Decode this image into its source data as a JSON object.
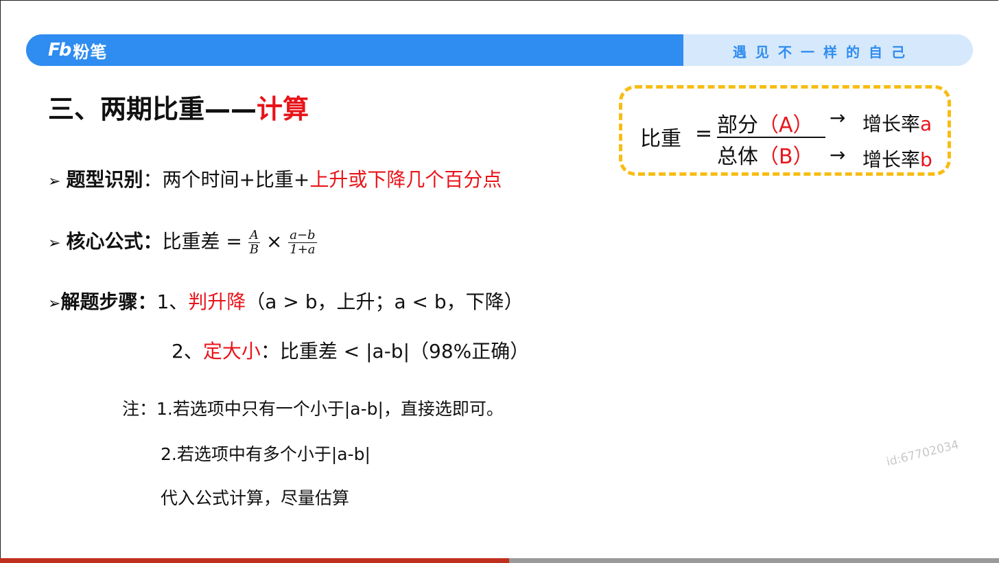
{
  "header": {
    "logo_mark": "Fb",
    "logo_text": "粉笔",
    "slogan": "遇见不一样的自己"
  },
  "title": {
    "prefix": "三、两期比重——",
    "highlight": "计算"
  },
  "rule1": {
    "bullet": "➢",
    "label": "题型识别",
    "colon": "：",
    "text": "两个时间+比重+",
    "highlight": "上升或下降几个百分点"
  },
  "rule2": {
    "bullet": "➢",
    "label": "核心公式：",
    "text": "比重差 = ",
    "frac1_num": "A",
    "frac1_den": "B",
    "times": " × ",
    "frac2_num": "a−b",
    "frac2_den": "1+a"
  },
  "steps": {
    "bullet": "➢",
    "label": "解题步骤：",
    "step1_num": "1、",
    "step1_key": "判升降",
    "step1_text": "（a > b，上升；a < b，下降）",
    "step2_num": "2、",
    "step2_key": "定大小",
    "step2_text": "：比重差 < |a-b|（98%正确）"
  },
  "notes": {
    "label": "注：",
    "note1": "1.若选项中只有一个小于|a-b|，直接选即可。",
    "note2": "2.若选项中有多个小于|a-b|",
    "note3": "代入公式计算，尽量估算"
  },
  "box": {
    "lhs": "比重",
    "eq": "=",
    "num_text": "部分",
    "num_tag": "（A）",
    "den_text": "总体",
    "den_tag": "（B）",
    "arrow": "→",
    "rate1_text": "增长率",
    "rate1_var": "a",
    "rate2_text": "增长率",
    "rate2_var": "b"
  },
  "watermark": "id:67702034",
  "colors": {
    "accent_blue": "#2f8cf0",
    "highlight_red": "#e8141a",
    "box_border": "#f7bd14"
  }
}
